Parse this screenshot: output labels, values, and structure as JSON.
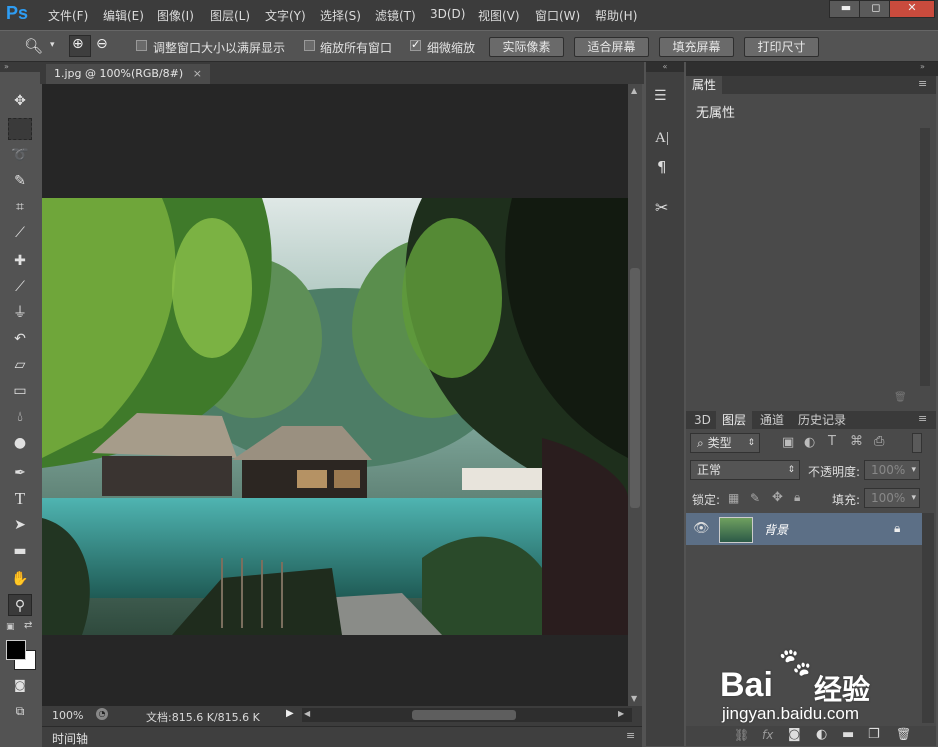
{
  "app": {
    "logo": "Ps"
  },
  "menu": [
    "文件(F)",
    "编辑(E)",
    "图像(I)",
    "图层(L)",
    "文字(Y)",
    "选择(S)",
    "滤镜(T)",
    "3D(D)",
    "视图(V)",
    "窗口(W)",
    "帮助(H)"
  ],
  "window_controls": {
    "minimize": "▬",
    "maximize": "◻",
    "close": "✕"
  },
  "options_bar": {
    "checkbox_resize": {
      "label": "调整窗口大小以满屏显示",
      "checked": false
    },
    "checkbox_zoom_all": {
      "label": "缩放所有窗口",
      "checked": false
    },
    "checkbox_scrubby": {
      "label": "细微缩放",
      "checked": true
    },
    "btn_actual_pixels": "实际像素",
    "btn_fit_screen": "适合屏幕",
    "btn_fill_screen": "填充屏幕",
    "btn_print_size": "打印尺寸"
  },
  "document": {
    "tab_title": "1.jpg @ 100%(RGB/8#)",
    "close": "×"
  },
  "status": {
    "zoom": "100%",
    "doc_info": "文档:815.6 K/815.6 K"
  },
  "timeline": {
    "label": "时间轴"
  },
  "properties": {
    "tab": "属性",
    "content": "无属性"
  },
  "layers_panel": {
    "tabs": [
      "3D",
      "图层",
      "通道",
      "历史记录"
    ],
    "active_tab": "图层",
    "filter_kind": "类型",
    "blend_mode": "正常",
    "opacity_label": "不透明度:",
    "opacity_value": "100%",
    "lock_label": "锁定:",
    "fill_label": "填充:",
    "fill_value": "100%",
    "layers": [
      {
        "name": "背景",
        "visible": true,
        "locked": true
      }
    ]
  },
  "watermark": {
    "brand": "Bai",
    "brand2": "经验",
    "url": "jingyan.baidu.com"
  },
  "colors": {
    "accent_ps": "#2e9df4",
    "panel": "#4a4a4a",
    "layer_selected": "#5c6f86"
  }
}
